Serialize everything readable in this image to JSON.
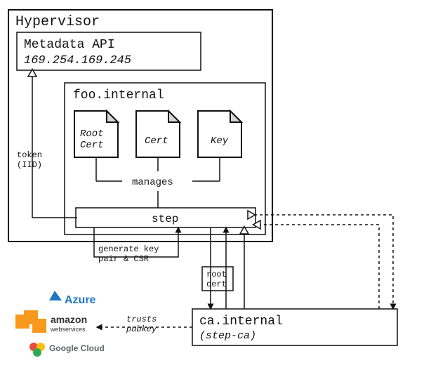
{
  "hypervisor": {
    "title": "Hypervisor",
    "metadata": {
      "title": "Metadata API",
      "ip": "169.254.169.245"
    },
    "token_label_1": "token",
    "token_label_2": "(IID)",
    "vm": {
      "title": "foo.internal",
      "docs": {
        "root_cert_l1": "Root",
        "root_cert_l2": "Cert",
        "cert": "Cert",
        "key": "Key"
      },
      "manages": "manages",
      "step": "step"
    }
  },
  "edges": {
    "generate_l1": "generate key",
    "generate_l2": "pair & CSR",
    "root_cert_l1": "root",
    "root_cert_l2": "cert",
    "trusts_l1": "trusts",
    "trusts_l2": "pubkey"
  },
  "ca": {
    "title": "ca.internal",
    "subtitle": "(step-ca)"
  },
  "clouds": {
    "azure": "Azure",
    "aws_l1": "amazon",
    "aws_l2": "webservices",
    "gcp": "Google Cloud"
  }
}
